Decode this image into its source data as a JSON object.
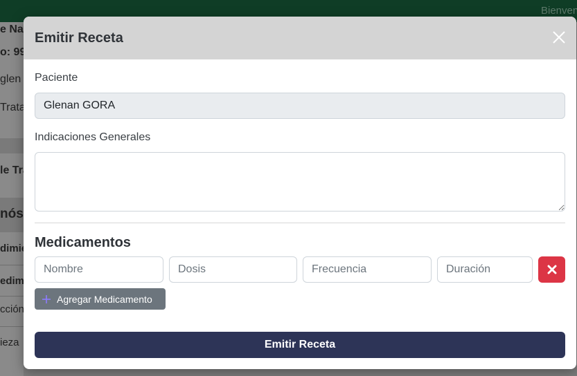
{
  "background": {
    "welcome_text": "Bienvenido",
    "lines": [
      "e Na",
      "o: 99",
      "glen",
      "Trata",
      "le Tra",
      "nóst",
      "dimie",
      "edim",
      "cción",
      "ieza"
    ]
  },
  "modal": {
    "title": "Emitir Receta",
    "patient_label": "Paciente",
    "patient_value": "Glenan GORA",
    "indications_label": "Indicaciones Generales",
    "indications_value": "",
    "medications_title": "Medicamentos",
    "medication_row": {
      "name_placeholder": "Nombre",
      "dose_placeholder": "Dosis",
      "frequency_placeholder": "Frecuencia",
      "duration_placeholder": "Duración"
    },
    "add_medication_label": "Agregar Medicamento",
    "submit_label": "Emitir Receta"
  },
  "colors": {
    "topbar": "#0f3d26",
    "primary": "#2d3457",
    "danger": "#dc3545",
    "secondary": "#6c757d",
    "add_icon": "#8e7cff"
  },
  "icons": {
    "close": "close-icon",
    "remove": "x-icon",
    "add": "plus-icon"
  }
}
